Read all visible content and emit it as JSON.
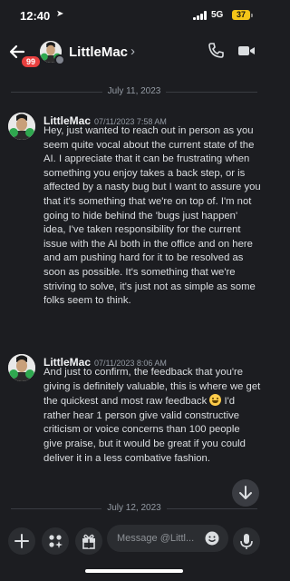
{
  "status_bar": {
    "time": "12:40",
    "network": "5G",
    "battery": "37"
  },
  "header": {
    "badge": "99",
    "name": "LittleMac",
    "chevron": "›"
  },
  "messages": [
    {
      "divider": "July 11, 2023",
      "author": "LittleMac",
      "time": "07/11/2023 7:58 AM",
      "text": "Hey, just wanted to reach out in person as you seem quite vocal about the current state of the AI. I appreciate that it can be frustrating when something you enjoy takes a back step, or is affected by a nasty bug but I want to assure you that it's something that we're on top of. I'm not going to hide behind the 'bugs just happen' idea, I've taken responsibility for the current issue with the AI both in the office and on here and am pushing hard for it to be resolved as soon as possible. It's something that we're striving to solve, it's just not as simple as some folks seem to think."
    },
    {
      "author": "LittleMac",
      "time": "07/11/2023 8:06 AM",
      "text_before": "And just to confirm, the feedback that you're giving is definitely valuable, this is where we get the quickest and most raw feedback",
      "emoji": "grinning-face",
      "text_after": " I'd rather hear 1 person give valid constructive criticism or voice concerns than 100 people give praise, but it would be great if you could deliver it in a less combative fashion."
    }
  ],
  "next_divider": "July 12, 2023",
  "composer": {
    "placeholder": "Message @Littl..."
  },
  "icons": {
    "back": "arrow-left-icon",
    "call": "phone-icon",
    "video": "video-camera-icon",
    "plus": "plus-icon",
    "apps": "apps-icon",
    "gift": "gift-icon",
    "emoji": "smiley-icon",
    "mic": "microphone-icon",
    "jump": "arrow-down-icon"
  },
  "colors": {
    "background": "#1c1d21",
    "badge": "#e8403f",
    "battery": "#f5c518"
  }
}
